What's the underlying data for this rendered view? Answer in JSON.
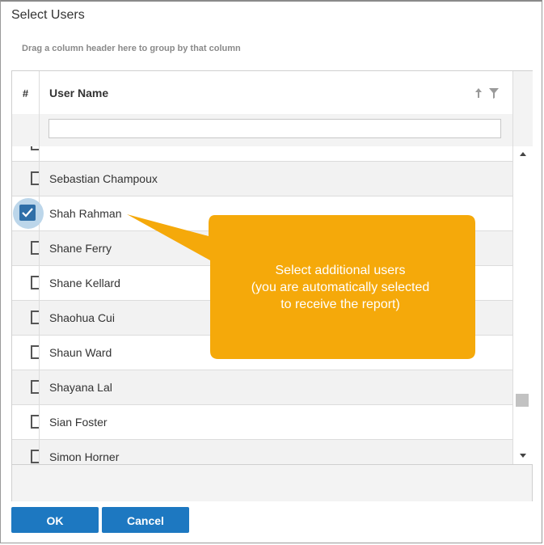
{
  "dialog": {
    "title": "Select Users",
    "group_hint": "Drag a column header here to group by that column"
  },
  "grid": {
    "columns": {
      "hash": "#",
      "user_name": "User Name"
    },
    "filter_value": "",
    "rows": [
      {
        "name": "Sebastian Champoux",
        "checked": false
      },
      {
        "name": "Shah Rahman",
        "checked": true
      },
      {
        "name": "Shane Ferry",
        "checked": false
      },
      {
        "name": "Shane Kellard",
        "checked": false
      },
      {
        "name": "Shaohua Cui",
        "checked": false
      },
      {
        "name": "Shaun Ward",
        "checked": false
      },
      {
        "name": "Shayana Lal",
        "checked": false
      },
      {
        "name": "Sian Foster",
        "checked": false
      },
      {
        "name": "Simon Horner",
        "checked": false
      }
    ]
  },
  "buttons": {
    "ok": "OK",
    "cancel": "Cancel"
  },
  "callout": {
    "lines": [
      "Select additional users",
      "(you are automatically selected",
      "to receive the report)"
    ],
    "color": "#f5a90a"
  },
  "icons": {
    "sort": "sort-arrow-icon",
    "filter": "filter-icon",
    "checkbox": "checkbox-icon"
  },
  "colors": {
    "button": "#1d78c1",
    "checked": "#2f6fa8"
  }
}
